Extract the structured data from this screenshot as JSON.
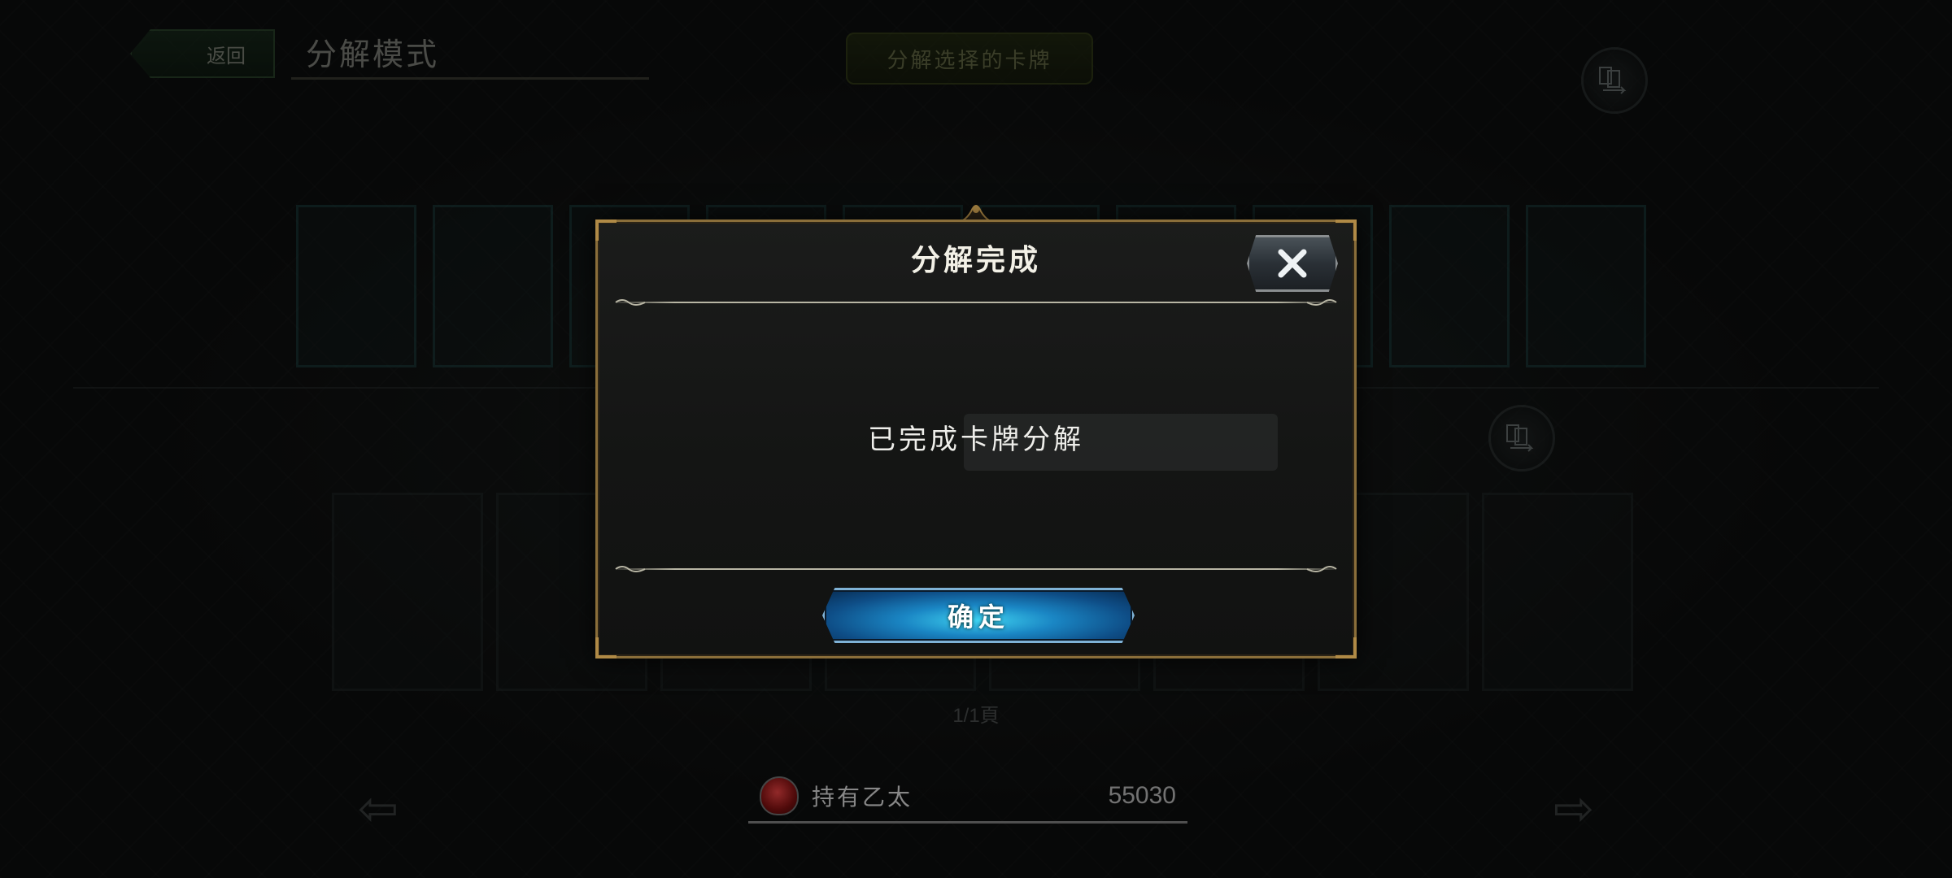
{
  "header": {
    "back_label": "返回",
    "mode_title": "分解模式",
    "decompose_selected_label": "分解选择的卡牌"
  },
  "footer": {
    "page_indicator": "1/1頁",
    "currency_label": "持有乙太",
    "currency_value": "55030"
  },
  "modal": {
    "title": "分解完成",
    "message": "已完成卡牌分解",
    "confirm_label": "确定",
    "close_icon": "close-icon"
  },
  "colors": {
    "modal_border": "#8a6e3a",
    "confirm_accent": "#1a86c4",
    "back_button": "#1d3a22"
  }
}
